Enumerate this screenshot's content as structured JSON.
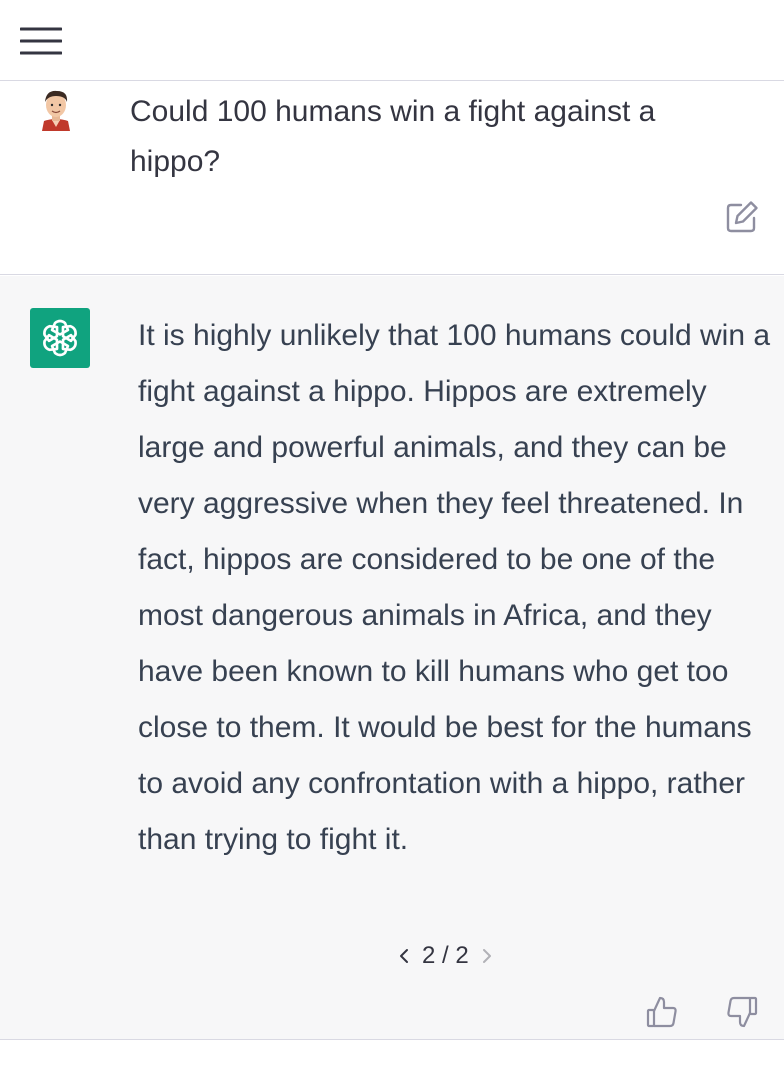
{
  "header": {
    "menu_icon": "hamburger-menu-icon"
  },
  "user_message": {
    "avatar_icon": "user-avatar",
    "text": "Could 100 humans win a fight against a hippo?",
    "edit_icon": "edit-icon"
  },
  "assistant_message": {
    "avatar_icon": "openai-logo-icon",
    "avatar_color": "#10a37f",
    "text": "It is highly unlikely that 100 humans could win a fight against a hippo. Hippos are extremely large and powerful animals, and they can be very aggressive when they feel threatened. In fact, hippos are considered to be one of the most dangerous animals in Africa, and they have been known to kill humans who get too close to them. It would be best for the humans to avoid any confrontation with a hippo, rather than trying to fight it.",
    "pager": {
      "label": "2 / 2",
      "prev_icon": "chevron-left-icon",
      "next_icon": "chevron-right-icon"
    },
    "feedback": {
      "up_icon": "thumbs-up-icon",
      "down_icon": "thumbs-down-icon"
    }
  }
}
